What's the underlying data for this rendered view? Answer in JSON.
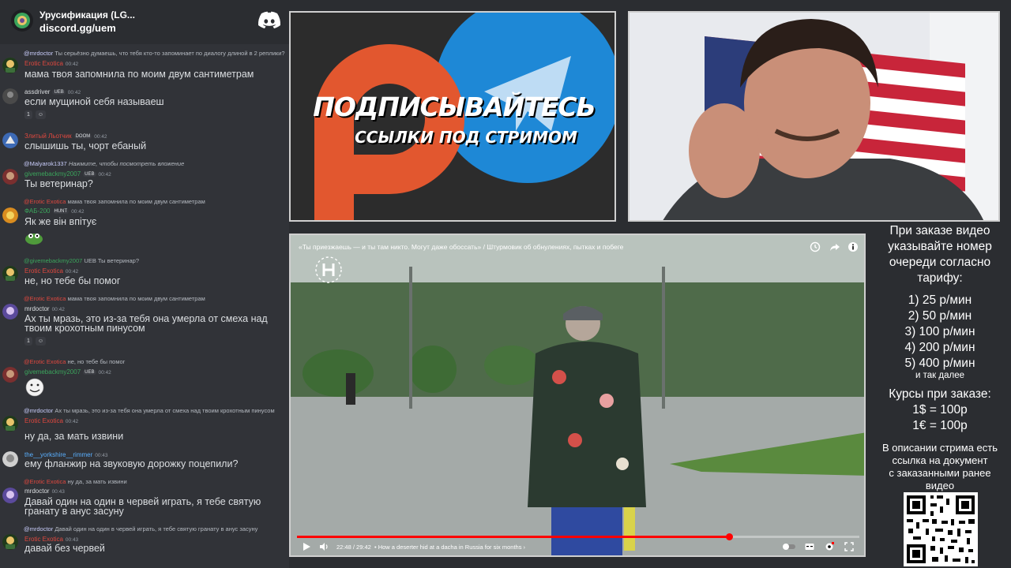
{
  "chat": {
    "server_title": "Урусификация (LG...",
    "server_link": "discord.gg/uem",
    "messages": [
      {
        "reply_name": "@mrdoctor",
        "reply_text": "Ты серьёзно думаешь, что тебя кто-то запоминает по диалогу длиной в 2 реплики?",
        "name": "Erotic Exotica",
        "time": "00:42",
        "text": "мама твоя запомнила по моим двум сантиметрам"
      },
      {
        "name": "assdriver",
        "tag": "UEB",
        "time": "00:42",
        "text": "если мущиной себя называеш",
        "reactions": [
          "1",
          ""
        ]
      },
      {
        "name": "Злитый Льотчик",
        "tag": "DOOM",
        "time": "00:42",
        "text": "слышишь ты, чорт ебаный"
      },
      {
        "reply_name": "@Malyarok1337",
        "reply_text": "Нажмите, чтобы посмотреть вложение",
        "name": "givemebackmy2007",
        "tag": "UEB",
        "time": "00:42",
        "text": "Ты ветеринар?"
      },
      {
        "reply_name": "@Erotic Exotica",
        "reply_text": "мама твоя запомнила по моим двум сантиметрам",
        "name": "ФАБ-200",
        "tag": "HUNT",
        "time": "00:42",
        "text": "Як же він впітує"
      },
      {
        "reply_name": "@givemebackmy2007",
        "reply_text": "UEB Ты ветеринар?",
        "name": "Erotic Exotica",
        "time": "00:42",
        "text": "не, но тебе бы помог"
      },
      {
        "reply_name": "@Erotic Exotica",
        "reply_text": "мама твоя запомнила по моим двум сантиметрам",
        "name": "mrdoctor",
        "time": "00:42",
        "text": "Ах ты мразь, это из-за тебя она умерла от смеха над",
        "text2": "твоим крохотным пинусом",
        "reactions": [
          "1",
          ""
        ]
      },
      {
        "reply_name": "@Erotic Exotica",
        "reply_text": "не, но тебе бы помог",
        "name": "givemebackmy2007",
        "tag": "UEB",
        "time": "00:42"
      },
      {
        "reply_name": "@mrdoctor",
        "reply_text": "Ах ты мразь, это из-за тебя она умерла от смеха над твоим крохотным пинусом",
        "name": "Erotic Exotica",
        "time": "00:42",
        "text": "ну да, за мать извини"
      },
      {
        "name": "the__yorkshire__rimmer",
        "time": "00:43",
        "text": "ему фланжир на звуковую дорожку поцепили?"
      },
      {
        "reply_name": "@Erotic Exotica",
        "reply_text": "ну да, за мать извини",
        "name": "mrdoctor",
        "time": "00:43",
        "text": "Давай один на один в червей играть, я тебе святую",
        "text2": "гранату в анус засуну"
      },
      {
        "reply_name": "@mrdoctor",
        "reply_text": "Давай один на один в червей играть, я тебе святую гранату в анус засуну",
        "name": "Erotic Exotica",
        "time": "00:43",
        "text": "давай без червей"
      }
    ]
  },
  "promo": {
    "title": "ПОДПИСЫВАЙТЕСЬ",
    "subtitle": "ССЫЛКИ ПОД СТРИМОМ"
  },
  "video": {
    "title": "«Ты приезжаешь — и ты там никто. Могут даже обоссать» / Штурмовик об обнулениях, пытках и побеге",
    "time": "22:48 / 29:42",
    "chapter": "• How a deserter hid at a dacha in Russia for six months  ›",
    "progress": 0.768
  },
  "info": {
    "l1": "При заказе видео",
    "l2": "указывайте номер",
    "l3": "очереди согласно",
    "l4": "тарифу:",
    "prices": [
      "1) 25 р/мин",
      "2) 50 р/мин",
      "3) 100 р/мин",
      "4) 200 р/мин",
      "5) 400 р/мин"
    ],
    "etc": "и так далее",
    "rates_title": "Курсы при заказе:",
    "rate_usd": "1$ = 100р",
    "rate_eur": "1€ = 100р",
    "d1": "В описании стрима есть",
    "d2": "ссылка на документ",
    "d3": "с заказанными ранее",
    "d4": "видео"
  },
  "colors": {
    "discord_bg": "#313338",
    "name_red": "#e0483f",
    "name_green": "#3ba55c",
    "name_blue": "#5ab0ff",
    "progress_red": "#ff0000"
  }
}
